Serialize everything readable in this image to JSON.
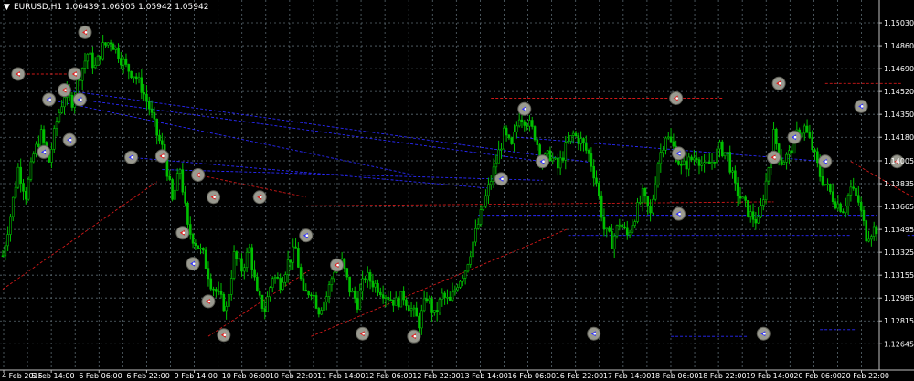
{
  "window": {
    "title_text": "EURUSD,H1  1.06439 1.06505 1.05942 1.05942",
    "menu_glyph": "▼"
  },
  "colors": {
    "background": "#000000",
    "grid": "#5a6870",
    "candle_up": "#00c000",
    "candle_down": "#00c000",
    "buy_line": "#2a2aff",
    "sell_line": "#d01818",
    "marker_fill": "#9a9a90",
    "text": "#ffffff"
  },
  "chart_data": {
    "type": "candlestick",
    "symbol": "EURUSD",
    "timeframe": "H1",
    "ohlc_header": {
      "open": 1.06439,
      "high": 1.06505,
      "low": 1.05942,
      "close": 1.05942
    },
    "ylim": [
      1.1245,
      1.152
    ],
    "y_ticks": [
      "1.15030",
      "1.14860",
      "1.14690",
      "1.14520",
      "1.14350",
      "1.14180",
      "1.14005",
      "1.13835",
      "1.13665",
      "1.13495",
      "1.13325",
      "1.13155",
      "1.12985",
      "1.12815",
      "1.12645"
    ],
    "y_tick_values": [
      1.1503,
      1.1486,
      1.1469,
      1.1452,
      1.1435,
      1.1418,
      1.14005,
      1.13835,
      1.13665,
      1.13495,
      1.13325,
      1.13155,
      1.12985,
      1.12815,
      1.12645
    ],
    "x_ticks": [
      "4 Feb 2015",
      "5 Feb 14:00",
      "6 Feb 06:00",
      "6 Feb 22:00",
      "9 Feb 14:00",
      "10 Feb 06:00",
      "10 Feb 22:00",
      "11 Feb 14:00",
      "12 Feb 06:00",
      "12 Feb 22:00",
      "13 Feb 14:00",
      "16 Feb 06:00",
      "16 Feb 22:00",
      "17 Feb 14:00",
      "18 Feb 06:00",
      "18 Feb 22:00",
      "19 Feb 14:00",
      "20 Feb 06:00",
      "20 Feb 22:00"
    ],
    "grid": true,
    "price_path": [
      [
        0,
        1.133
      ],
      [
        3,
        1.136
      ],
      [
        6,
        1.1395
      ],
      [
        9,
        1.1375
      ],
      [
        12,
        1.1405
      ],
      [
        15,
        1.142
      ],
      [
        18,
        1.14
      ],
      [
        21,
        1.143
      ],
      [
        24,
        1.145
      ],
      [
        27,
        1.1445
      ],
      [
        30,
        1.1465
      ],
      [
        33,
        1.148
      ],
      [
        36,
        1.147
      ],
      [
        39,
        1.1485
      ],
      [
        42,
        1.149
      ],
      [
        45,
        1.148
      ],
      [
        48,
        1.147
      ],
      [
        51,
        1.1465
      ],
      [
        54,
        1.1455
      ],
      [
        57,
        1.144
      ],
      [
        60,
        1.142
      ],
      [
        63,
        1.1405
      ],
      [
        66,
        1.137
      ],
      [
        69,
        1.1395
      ],
      [
        72,
        1.135
      ],
      [
        75,
        1.134
      ],
      [
        78,
        1.133
      ],
      [
        81,
        1.131
      ],
      [
        84,
        1.13
      ],
      [
        87,
        1.129
      ],
      [
        90,
        1.133
      ],
      [
        93,
        1.132
      ],
      [
        96,
        1.1335
      ],
      [
        99,
        1.13
      ],
      [
        102,
        1.129
      ],
      [
        105,
        1.1315
      ],
      [
        108,
        1.131
      ],
      [
        111,
        1.1325
      ],
      [
        114,
        1.1335
      ],
      [
        117,
        1.13
      ],
      [
        120,
        1.1305
      ],
      [
        123,
        1.129
      ],
      [
        126,
        1.13
      ],
      [
        129,
        1.132
      ],
      [
        132,
        1.1325
      ],
      [
        135,
        1.1305
      ],
      [
        138,
        1.1295
      ],
      [
        141,
        1.1315
      ],
      [
        144,
        1.131
      ],
      [
        147,
        1.1305
      ],
      [
        150,
        1.13
      ],
      [
        153,
        1.1295
      ],
      [
        156,
        1.13
      ],
      [
        159,
        1.129
      ],
      [
        162,
        1.128
      ],
      [
        165,
        1.13
      ],
      [
        168,
        1.1285
      ],
      [
        171,
        1.13
      ],
      [
        174,
        1.1295
      ],
      [
        177,
        1.131
      ],
      [
        180,
        1.132
      ],
      [
        183,
        1.134
      ],
      [
        186,
        1.136
      ],
      [
        189,
        1.138
      ],
      [
        192,
        1.14
      ],
      [
        195,
        1.142
      ],
      [
        198,
        1.141
      ],
      [
        201,
        1.1435
      ],
      [
        204,
        1.143
      ],
      [
        207,
        1.142
      ],
      [
        210,
        1.14
      ],
      [
        213,
        1.1405
      ],
      [
        216,
        1.1395
      ],
      [
        219,
        1.141
      ],
      [
        222,
        1.142
      ],
      [
        225,
        1.1415
      ],
      [
        228,
        1.1405
      ],
      [
        231,
        1.1385
      ],
      [
        234,
        1.135
      ],
      [
        237,
        1.134
      ],
      [
        240,
        1.1355
      ],
      [
        243,
        1.1345
      ],
      [
        246,
        1.136
      ],
      [
        249,
        1.1375
      ],
      [
        252,
        1.136
      ],
      [
        255,
        1.14
      ],
      [
        258,
        1.142
      ],
      [
        261,
        1.141
      ],
      [
        264,
        1.1395
      ],
      [
        267,
        1.14
      ],
      [
        270,
        1.1405
      ],
      [
        273,
        1.1395
      ],
      [
        276,
        1.14
      ],
      [
        279,
        1.141
      ],
      [
        282,
        1.1405
      ],
      [
        285,
        1.138
      ],
      [
        288,
        1.137
      ],
      [
        291,
        1.136
      ],
      [
        294,
        1.1355
      ],
      [
        297,
        1.1385
      ],
      [
        300,
        1.142
      ],
      [
        303,
        1.14
      ],
      [
        306,
        1.1405
      ],
      [
        309,
        1.142
      ],
      [
        312,
        1.1425
      ],
      [
        315,
        1.141
      ],
      [
        318,
        1.139
      ],
      [
        321,
        1.138
      ],
      [
        324,
        1.137
      ],
      [
        327,
        1.1365
      ],
      [
        330,
        1.138
      ],
      [
        333,
        1.137
      ],
      [
        336,
        1.1345
      ],
      [
        339,
        1.135
      ]
    ],
    "trade_markers": [
      {
        "t": 18,
        "p": 1.1446,
        "dir": "buy"
      },
      {
        "t": 24,
        "p": 1.1453,
        "dir": "sell"
      },
      {
        "t": 30,
        "p": 1.1446,
        "dir": "buy"
      },
      {
        "t": 6,
        "p": 1.1465,
        "dir": "sell"
      },
      {
        "t": 28,
        "p": 1.1465,
        "dir": "sell"
      },
      {
        "t": 32,
        "p": 1.1496,
        "dir": "sell"
      },
      {
        "t": 16,
        "p": 1.1407,
        "dir": "buy"
      },
      {
        "t": 26,
        "p": 1.1416,
        "dir": "buy"
      },
      {
        "t": 50,
        "p": 1.1403,
        "dir": "buy"
      },
      {
        "t": 62,
        "p": 1.1404,
        "dir": "sell"
      },
      {
        "t": 76,
        "p": 1.139,
        "dir": "sell"
      },
      {
        "t": 82,
        "p": 1.13735,
        "dir": "sell"
      },
      {
        "t": 100,
        "p": 1.13735,
        "dir": "sell"
      },
      {
        "t": 118,
        "p": 1.1345,
        "dir": "buy"
      },
      {
        "t": 130,
        "p": 1.1323,
        "dir": "sell"
      },
      {
        "t": 160,
        "p": 1.127,
        "dir": "sell"
      },
      {
        "t": 194,
        "p": 1.1387,
        "dir": "buy"
      },
      {
        "t": 203,
        "p": 1.1439,
        "dir": "buy"
      },
      {
        "t": 210,
        "p": 1.14,
        "dir": "buy"
      },
      {
        "t": 263,
        "p": 1.1361,
        "dir": "buy"
      },
      {
        "t": 263,
        "p": 1.1406,
        "dir": "buy"
      },
      {
        "t": 300,
        "p": 1.1403,
        "dir": "sell"
      },
      {
        "t": 308,
        "p": 1.1418,
        "dir": "buy"
      },
      {
        "t": 320,
        "p": 1.14,
        "dir": "buy"
      },
      {
        "t": 334,
        "p": 1.1441,
        "dir": "buy"
      },
      {
        "t": 348,
        "p": 1.14,
        "dir": "sell"
      },
      {
        "t": 382,
        "p": 1.14,
        "dir": "sell"
      },
      {
        "t": 388,
        "p": 1.13755,
        "dir": "sell"
      },
      {
        "t": 390,
        "p": 1.13655,
        "dir": "buy"
      },
      {
        "t": 262,
        "p": 1.1447,
        "dir": "sell"
      },
      {
        "t": 70,
        "p": 1.1347,
        "dir": "sell"
      },
      {
        "t": 74,
        "p": 1.1324,
        "dir": "buy"
      },
      {
        "t": 80,
        "p": 1.1296,
        "dir": "sell"
      },
      {
        "t": 86,
        "p": 1.1271,
        "dir": "sell"
      },
      {
        "t": 140,
        "p": 1.1272,
        "dir": "sell"
      },
      {
        "t": 230,
        "p": 1.1272,
        "dir": "buy"
      },
      {
        "t": 296,
        "p": 1.1272,
        "dir": "buy"
      },
      {
        "t": 302,
        "p": 1.1458,
        "dir": "sell"
      },
      {
        "t": 380,
        "p": 1.1452,
        "dir": "sell"
      },
      {
        "t": 372,
        "p": 1.1266,
        "dir": "buy"
      },
      {
        "t": 378,
        "p": 1.1275,
        "dir": "sell"
      }
    ],
    "trade_lines": [
      {
        "t1": 6,
        "p1": 1.1465,
        "t2": 28,
        "p2": 1.1465,
        "dir": "sell"
      },
      {
        "t1": 18,
        "p1": 1.1446,
        "t2": 160,
        "p2": 1.139,
        "dir": "buy"
      },
      {
        "t1": 24,
        "p1": 1.1453,
        "t2": 230,
        "p2": 1.1399,
        "dir": "buy"
      },
      {
        "t1": 30,
        "p1": 1.1446,
        "t2": 210,
        "p2": 1.14,
        "dir": "buy"
      },
      {
        "t1": 50,
        "p1": 1.1403,
        "t2": 190,
        "p2": 1.138,
        "dir": "buy"
      },
      {
        "t1": 62,
        "p1": 1.1394,
        "t2": 210,
        "p2": 1.1386,
        "dir": "buy"
      },
      {
        "t1": 76,
        "p1": 1.139,
        "t2": 118,
        "p2": 1.13735,
        "dir": "sell"
      },
      {
        "t1": 118,
        "p1": 1.1367,
        "t2": 300,
        "p2": 1.137,
        "dir": "sell"
      },
      {
        "t1": 190,
        "p1": 1.1447,
        "t2": 280,
        "p2": 1.1447,
        "dir": "sell"
      },
      {
        "t1": 200,
        "p1": 1.1418,
        "t2": 320,
        "p2": 1.14,
        "dir": "buy"
      },
      {
        "t1": 185,
        "p1": 1.136,
        "t2": 340,
        "p2": 1.136,
        "dir": "buy"
      },
      {
        "t1": 320,
        "p1": 1.1458,
        "t2": 350,
        "p2": 1.1458,
        "dir": "sell"
      },
      {
        "t1": 260,
        "p1": 1.127,
        "t2": 290,
        "p2": 1.127,
        "dir": "buy"
      },
      {
        "t1": 318,
        "p1": 1.1275,
        "t2": 332,
        "p2": 1.1275,
        "dir": "buy"
      },
      {
        "t1": 220,
        "p1": 1.1345,
        "t2": 330,
        "p2": 1.1345,
        "dir": "buy"
      },
      {
        "t1": 352,
        "p1": 1.1345,
        "t2": 380,
        "p2": 1.1345,
        "dir": "buy"
      },
      {
        "t1": 0,
        "p1": 1.1305,
        "t2": 60,
        "p2": 1.1385,
        "dir": "sell"
      },
      {
        "t1": 80,
        "p1": 1.127,
        "t2": 120,
        "p2": 1.132,
        "dir": "sell"
      },
      {
        "t1": 120,
        "p1": 1.127,
        "t2": 220,
        "p2": 1.135,
        "dir": "sell"
      },
      {
        "t1": 330,
        "p1": 1.14,
        "t2": 380,
        "p2": 1.1345,
        "dir": "sell"
      },
      {
        "t1": 360,
        "p1": 1.135,
        "t2": 390,
        "p2": 1.1285,
        "dir": "sell"
      }
    ]
  }
}
